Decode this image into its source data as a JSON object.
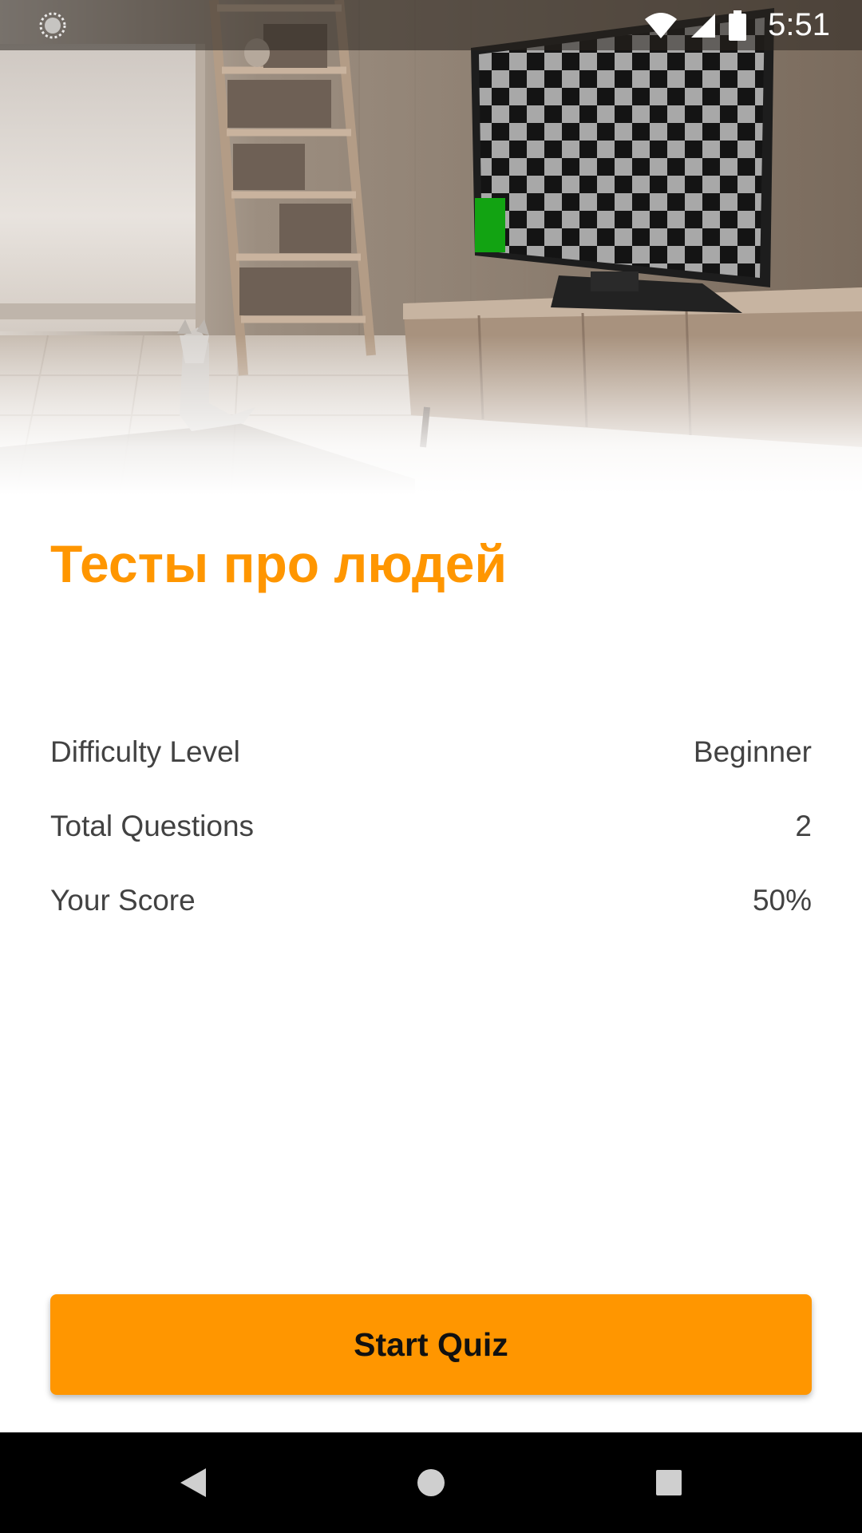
{
  "status_bar": {
    "time": "5:51",
    "icons": [
      "loading-circle-icon",
      "wifi-icon",
      "cell-signal-icon",
      "battery-icon"
    ]
  },
  "hero": {
    "description_icons": [
      "living-room-illustration",
      "tv-checkerboard",
      "cat-figurine",
      "bookshelf-ladder"
    ]
  },
  "quiz": {
    "title": "Тесты про людей",
    "rows": [
      {
        "label": "Difficulty Level",
        "value": "Beginner"
      },
      {
        "label": "Total Questions",
        "value": "2"
      },
      {
        "label": "Your Score",
        "value": "50%"
      }
    ],
    "start_button_label": "Start Quiz"
  },
  "nav_bar": {
    "icons": [
      "back-icon",
      "home-icon",
      "recents-icon"
    ]
  },
  "colors": {
    "accent": "#ff9600",
    "text": "#424242",
    "nav_background": "#000000",
    "tv_highlight": "#12a312"
  }
}
